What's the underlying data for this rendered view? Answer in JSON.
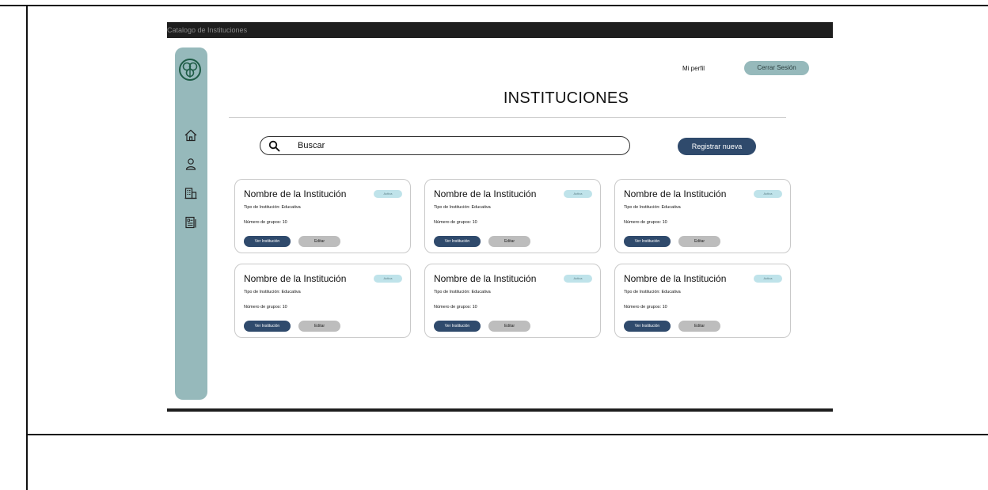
{
  "window": {
    "title": "Catalogo de Instituciones"
  },
  "sidebar": {
    "logo": "logo-icon",
    "items": [
      {
        "icon": "home-icon"
      },
      {
        "icon": "user-icon"
      },
      {
        "icon": "building-icon"
      },
      {
        "icon": "document-list-icon"
      }
    ]
  },
  "header": {
    "profile_label": "Mi perfil",
    "logout_label": "Cerrar Sesión"
  },
  "page": {
    "title": "INSTITUCIONES"
  },
  "search": {
    "placeholder": "Buscar",
    "icon": "search-icon"
  },
  "actions": {
    "register_label": "Registrar nueva"
  },
  "colors": {
    "primary": "#2f4a6c",
    "sidebar": "#96b9bb",
    "badge": "#bfe3ea",
    "secondary_button": "#bdbdbd"
  },
  "cards": [
    {
      "name": "Nombre de la Institución",
      "status": "Activa",
      "type": "Tipo de Institución:  Educativa",
      "groups": "Número de grupos: 10",
      "view_label": "Ver Institución",
      "edit_label": "Editar"
    },
    {
      "name": "Nombre de la Institución",
      "status": "Activa",
      "type": "Tipo de Institución:  Educativa",
      "groups": "Número de grupos: 10",
      "view_label": "Ver Institución",
      "edit_label": "Editar"
    },
    {
      "name": "Nombre de la Institución",
      "status": "Activa",
      "type": "Tipo de Institución:  Educativa",
      "groups": "Número de grupos: 10",
      "view_label": "Ver Institución",
      "edit_label": "Editar"
    },
    {
      "name": "Nombre de la Institución",
      "status": "Activa",
      "type": "Tipo de Institución:  Educativa",
      "groups": "Número de grupos: 10",
      "view_label": "Ver Institución",
      "edit_label": "Editar"
    },
    {
      "name": "Nombre de la Institución",
      "status": "Activa",
      "type": "Tipo de Institución:  Educativa",
      "groups": "Número de grupos: 10",
      "view_label": "Ver Institución",
      "edit_label": "Editar"
    },
    {
      "name": "Nombre de la Institución",
      "status": "Activa",
      "type": "Tipo de Institución:  Educativa",
      "groups": "Número de grupos: 10",
      "view_label": "Ver Institución",
      "edit_label": "Editar"
    }
  ]
}
